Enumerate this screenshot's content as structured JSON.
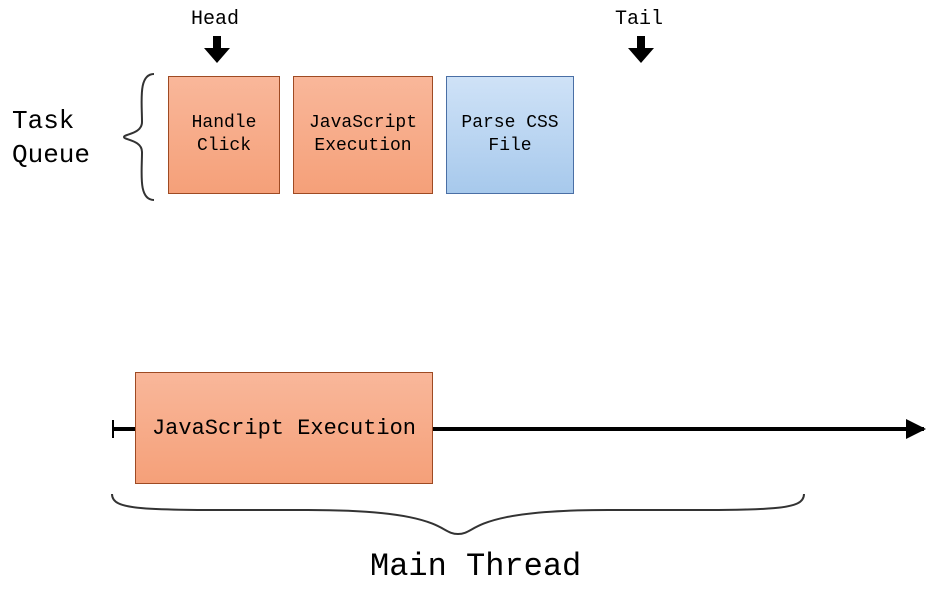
{
  "queue": {
    "label_line1": "Task",
    "label_line2": "Queue",
    "head_label": "Head",
    "tail_label": "Tail",
    "tasks": [
      {
        "name": "Handle Click",
        "color": "orange"
      },
      {
        "name": "JavaScript Execution",
        "color": "orange"
      },
      {
        "name": "Parse CSS File",
        "color": "blue"
      }
    ]
  },
  "main_thread": {
    "running_task": "JavaScript Execution",
    "label": "Main Thread"
  },
  "colors": {
    "orange": "#f5a079",
    "blue": "#a7c9ec"
  }
}
